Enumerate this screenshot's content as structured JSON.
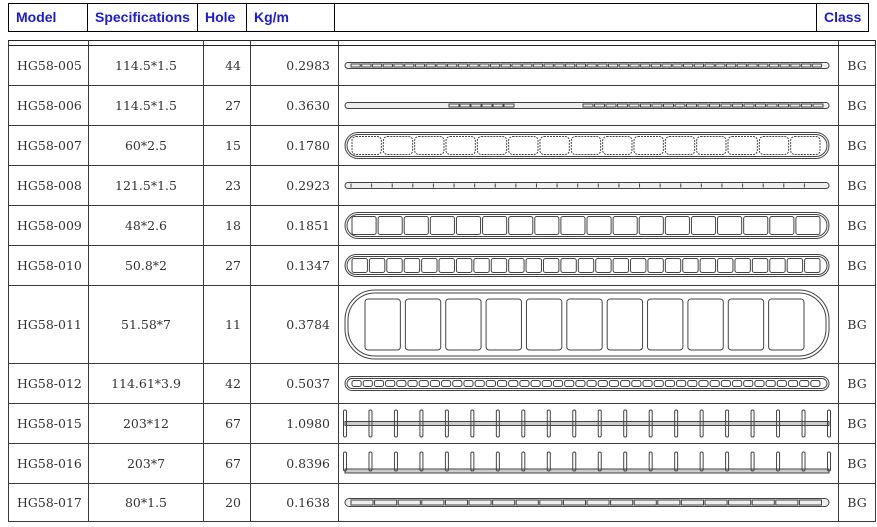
{
  "header": {
    "model": "Model",
    "specifications": "Specifications",
    "hole": "Hole",
    "kgm": "Kg/m",
    "profile": "",
    "class": "Class"
  },
  "colors": {
    "header_text": "#1a1adc",
    "border": "#000000",
    "cell_text": "#333333"
  },
  "rows": [
    {
      "model": "HG58-005",
      "spec": "114.5*1.5",
      "hole": "44",
      "kgm": "0.2983",
      "profile": "thin-flat-tube-small-rect-holes",
      "class": "BG"
    },
    {
      "model": "HG58-006",
      "spec": "114.5*1.5",
      "hole": "27",
      "kgm": "0.3630",
      "profile": "thin-flat-tube-two-hole-groups",
      "class": "BG"
    },
    {
      "model": "HG58-007",
      "spec": "60*2.5",
      "hole": "15",
      "kgm": "0.1780",
      "profile": "flat-tube-serrated-holes",
      "class": "BG"
    },
    {
      "model": "HG58-008",
      "spec": "121.5*1.5",
      "hole": "23",
      "kgm": "0.2923",
      "profile": "thin-flat-tube-slits",
      "class": "BG"
    },
    {
      "model": "HG58-009",
      "spec": "48*2.6",
      "hole": "18",
      "kgm": "0.1851",
      "profile": "flat-tube-square-holes",
      "class": "BG"
    },
    {
      "model": "HG58-010",
      "spec": "50.8*2",
      "hole": "27",
      "kgm": "0.1347",
      "profile": "flat-tube-rounded-square-holes",
      "class": "BG"
    },
    {
      "model": "HG58-011",
      "spec": "51.58*7",
      "hole": "11",
      "kgm": "0.3784",
      "profile": "thick-tube-notched-large-holes",
      "class": "BG"
    },
    {
      "model": "HG58-012",
      "spec": "114.61*3.9",
      "hole": "42",
      "kgm": "0.5037",
      "profile": "flat-tube-notched-small-holes",
      "class": "BG"
    },
    {
      "model": "HG58-015",
      "spec": "203*12",
      "hole": "67",
      "kgm": "1.0980",
      "profile": "finned-tube-double-sided",
      "class": "BG"
    },
    {
      "model": "HG58-016",
      "spec": "203*7",
      "hole": "67",
      "kgm": "0.8396",
      "profile": "finned-tube-single-sided",
      "class": "BG"
    },
    {
      "model": "HG58-017",
      "spec": "80*1.5",
      "hole": "20",
      "kgm": "0.1638",
      "profile": "thin-flat-tube-long-rect-holes",
      "class": "BG"
    }
  ]
}
